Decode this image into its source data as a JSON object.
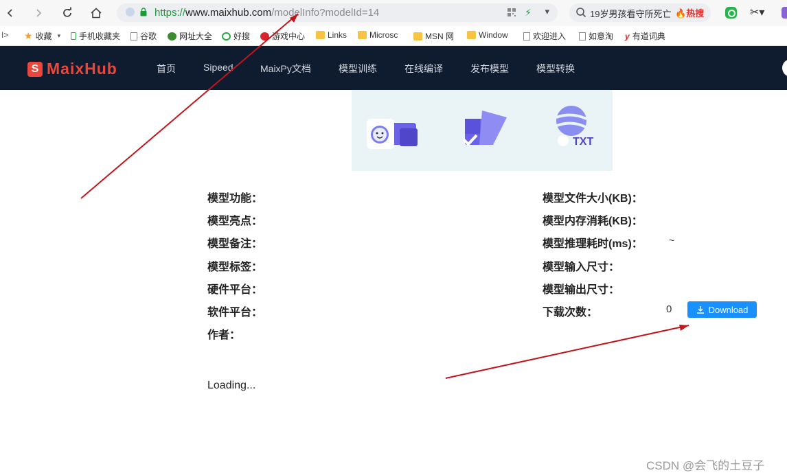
{
  "browser": {
    "url_protocol": "https://",
    "url_host": "www.maixhub.com",
    "url_path": "/modelInfo?modelId=14",
    "search_text": "19岁男孩看守所死亡",
    "search_hot": "热搜",
    "bookmarks": [
      "收藏",
      "手机收藏夹",
      "谷歌",
      "网址大全",
      "好搜",
      "游戏中心",
      "Links",
      "Microsc",
      "MSN 网",
      "Window",
      "欢迎进入",
      "如意淘",
      "有道词典"
    ]
  },
  "site": {
    "logo_text": "MaixHub",
    "menu": [
      "首页",
      "Sipeed",
      "MaixPy文档",
      "模型训练",
      "在线编译",
      "发布模型",
      "模型转换"
    ]
  },
  "banner": {
    "txt_label": "TXT"
  },
  "info": {
    "left_labels": [
      "模型功能：",
      "模型亮点：",
      "模型备注：",
      "模型标签：",
      "硬件平台：",
      "软件平台：",
      "作者："
    ],
    "right_labels": [
      "模型文件大小(KB)：",
      "模型内存消耗(KB)：",
      "模型推理耗时(ms)：",
      "模型输入尺寸：",
      "模型输出尺寸：",
      "下载次数："
    ],
    "inference_time_value": "~",
    "download_count": "0",
    "download_button": "Download"
  },
  "loading_text": "Loading...",
  "watermark": "CSDN @会飞的土豆子",
  "colors": {
    "header_bg": "#0f1b2e",
    "brand": "#e8473c",
    "button": "#1890ff",
    "arrow": "#c0161b",
    "banner_bg": "#eaf3f5"
  }
}
